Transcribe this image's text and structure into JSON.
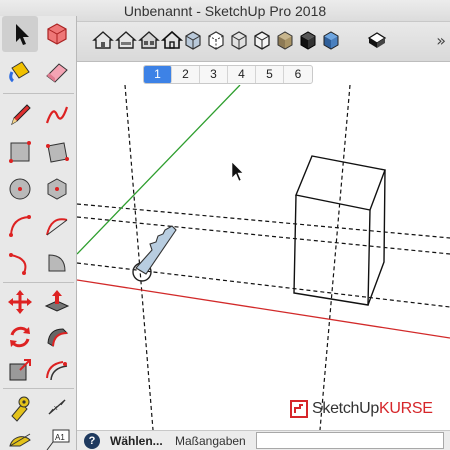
{
  "window": {
    "title": "Unbenannt - SketchUp Pro 2018"
  },
  "toolbar": {
    "buttons": [
      {
        "icon": "house-front-icon"
      },
      {
        "icon": "house-side-icon"
      },
      {
        "icon": "house-back-icon"
      },
      {
        "icon": "house-outline-icon"
      },
      {
        "icon": "xray-cube-icon"
      },
      {
        "icon": "backedge-cube-icon"
      },
      {
        "icon": "wireframe-cube-icon"
      },
      {
        "icon": "hidden-line-cube-icon"
      },
      {
        "icon": "shaded-cube-icon"
      },
      {
        "icon": "textured-cube-icon"
      },
      {
        "icon": "monochrome-cube-icon"
      },
      {
        "icon": "section-cube-icon"
      }
    ],
    "more": "»"
  },
  "scenes": {
    "tabs": [
      "1",
      "2",
      "3",
      "4",
      "5",
      "6"
    ],
    "active": "1"
  },
  "palette": {
    "tools": [
      "select-arrow-icon",
      "component-icon",
      "paint-bucket-icon",
      "eraser-icon",
      "pencil-icon",
      "freehand-icon",
      "rectangle-icon",
      "rotated-rectangle-icon",
      "circle-icon",
      "polygon-icon",
      "arc-icon",
      "two-point-arc-icon",
      "three-point-arc-icon",
      "pie-icon",
      "move-icon",
      "push-pull-icon",
      "rotate-icon",
      "follow-me-icon",
      "scale-icon",
      "offset-icon",
      "tape-measure-icon",
      "dimension-icon",
      "protractor-icon",
      "text-icon"
    ]
  },
  "status": {
    "help": "?",
    "text": "Wählen...",
    "measure_label": "Maßangaben",
    "measure_value": ""
  },
  "logo": {
    "brand": "SketchUp",
    "accent": "KURSE"
  },
  "colors": {
    "green_axis": "#2e9e2e",
    "red_axis": "#d22a2a",
    "active_tab": "#3d82e6"
  }
}
